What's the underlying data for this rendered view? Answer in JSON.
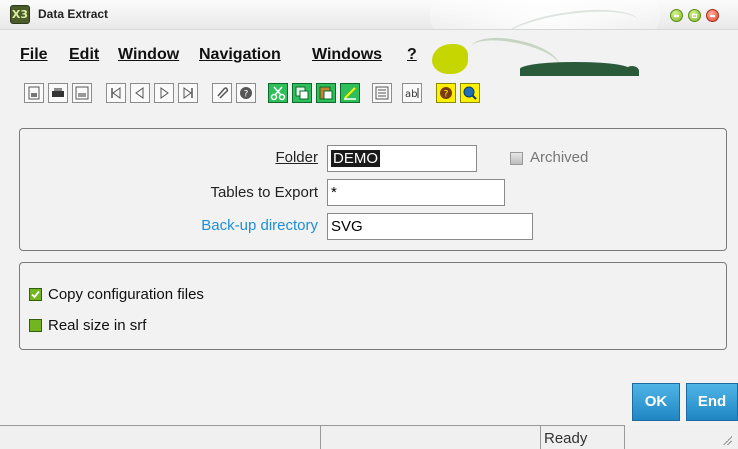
{
  "window": {
    "title": "Data Extract",
    "app_icon": "X3",
    "controls": [
      "minimize-icon",
      "maximize-icon",
      "close-icon"
    ]
  },
  "menu": {
    "items": [
      {
        "label": "File"
      },
      {
        "label": "Edit"
      },
      {
        "label": "Window"
      },
      {
        "label": "Navigation"
      },
      {
        "label": "Windows"
      },
      {
        "label": "?"
      }
    ]
  },
  "toolbar": {
    "icons": [
      "save-icon",
      "print-icon",
      "print-preview-icon",
      "first-record-icon",
      "previous-record-icon",
      "next-record-icon",
      "last-record-icon",
      "attachment-icon",
      "help-info-icon",
      "cut-icon",
      "copy-icon",
      "paste-icon",
      "edit-icon",
      "list-icon",
      "text-field-icon",
      "question-icon",
      "search-icon"
    ]
  },
  "form": {
    "folder_label": "Folder",
    "folder_value": "DEMO",
    "archived_label": "Archived",
    "tables_label": "Tables to Export",
    "tables_value": "*",
    "backup_label": "Back-up directory",
    "backup_value": "SVG"
  },
  "options": {
    "copy_config_label": "Copy configuration files",
    "real_size_label": "Real size in srf"
  },
  "buttons": {
    "ok_label": "OK",
    "end_label": "End"
  },
  "status": {
    "pane3": "Ready"
  },
  "colors": {
    "accent_blue": "#1e8fd6",
    "check_green": "#72b521",
    "button_blue": "#2a95d0"
  }
}
